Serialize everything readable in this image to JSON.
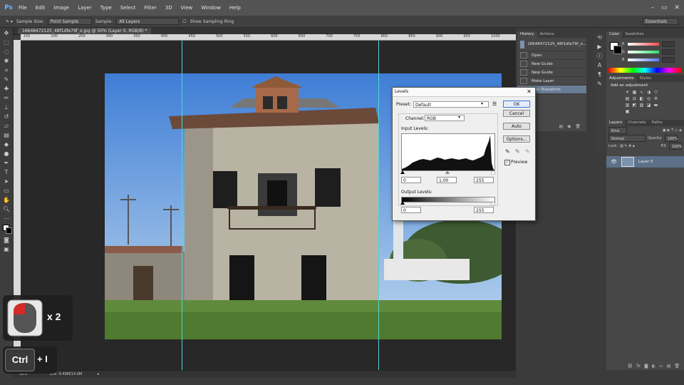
{
  "menu": [
    "File",
    "Edit",
    "Image",
    "Layer",
    "Type",
    "Select",
    "Filter",
    "3D",
    "View",
    "Window",
    "Help"
  ],
  "app_logo": "Ps",
  "window_controls": [
    "–",
    "▭",
    "✕"
  ],
  "options": {
    "sample_size_label": "Sample Size:",
    "sample_size_value": "Point Sample",
    "sample_label": "Sample:",
    "sample_value": "All Layers",
    "show_ring_label": "Show Sampling Ring",
    "workspace": "Essentials"
  },
  "document": {
    "tab_title": "16648472125_48f1dfe79f_o.jpg @ 50% (Layer 0, RGB/8) *",
    "ruler_ticks": [
      "0",
      "50",
      "100",
      "150",
      "200",
      "250",
      "300",
      "350",
      "400",
      "450",
      "500",
      "550",
      "600",
      "650",
      "700",
      "750",
      "800",
      "850",
      "900",
      "950",
      "1000",
      "1050",
      "1100",
      "1150",
      "1200",
      "1250",
      "1300",
      "1350",
      "1400",
      "1450",
      "1500",
      "1550",
      "1600",
      "1650",
      "1700",
      "1750"
    ],
    "zoom": "50%",
    "doc_size": "Doc: 9.40M/14.0M"
  },
  "history": {
    "tabs": [
      "History",
      "Actions"
    ],
    "snapshot": "16648472125_48f1dfe79f_o...",
    "items": [
      "Open",
      "New Guide",
      "New Guide",
      "Make Layer",
      "Free Transform"
    ]
  },
  "color_panel": {
    "tabs": [
      "Color",
      "Swatches"
    ],
    "sliders": [
      {
        "label": "R",
        "color": "#ff5a5a"
      },
      {
        "label": "G",
        "color": "#5aff5a"
      },
      {
        "label": "B",
        "color": "#5a8cff"
      }
    ]
  },
  "adjustments": {
    "tabs": [
      "Adjustments",
      "Styles"
    ],
    "header": "Add an adjustment"
  },
  "layers": {
    "tabs": [
      "Layers",
      "Channels",
      "Paths"
    ],
    "kind_label": "Kind",
    "blend_mode": "Normal",
    "opacity_label": "Opacity:",
    "opacity_value": "100%",
    "lock_label": "Lock:",
    "fill_label": "Fill:",
    "fill_value": "100%",
    "layer_name": "Layer 0"
  },
  "levels": {
    "title": "Levels",
    "preset_label": "Preset:",
    "preset_value": "Default",
    "channel_label": "Channel:",
    "channel_value": "RGB",
    "input_levels_label": "Input Levels:",
    "input_black": "0",
    "input_gamma": "1,00",
    "input_white": "255",
    "output_levels_label": "Output Levels:",
    "output_black": "0",
    "output_white": "255",
    "buttons": {
      "ok": "OK",
      "cancel": "Cancel",
      "auto": "Auto",
      "options": "Options..."
    },
    "preview_label": "Preview"
  },
  "overlays": {
    "click_count": "x 2",
    "shortcut_key": "Ctrl",
    "shortcut_rest": "+ I"
  }
}
